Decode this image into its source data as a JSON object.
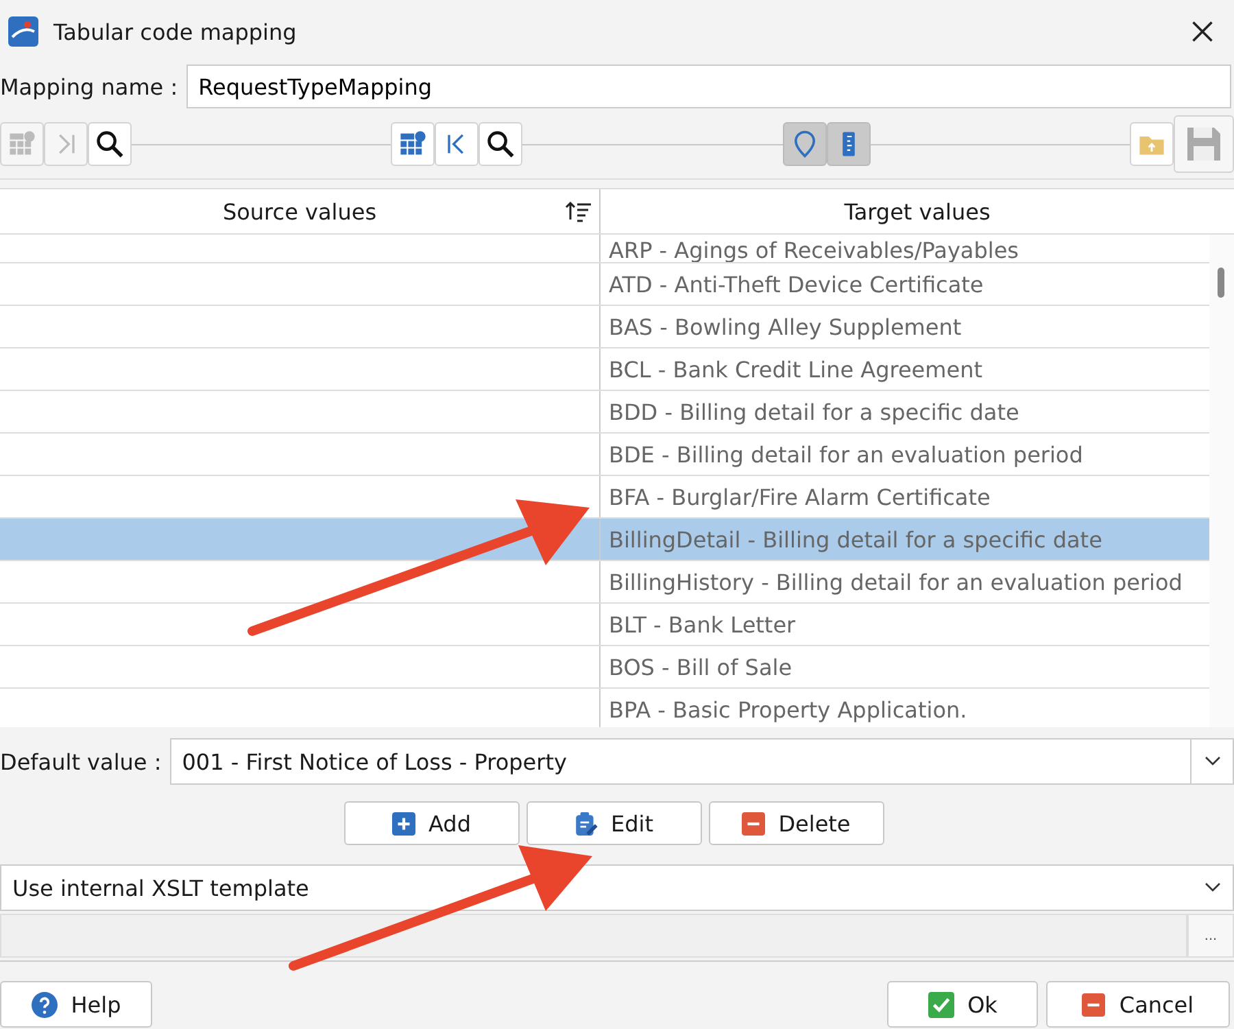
{
  "window": {
    "title": "Tabular code mapping"
  },
  "mapping": {
    "label": "Mapping name :",
    "value": "RequestTypeMapping"
  },
  "toolbar": [
    {
      "kind": "grid",
      "disabled": true,
      "pressed": false,
      "gap_after": false
    },
    {
      "kind": "last",
      "disabled": true,
      "pressed": false,
      "gap_after": false
    },
    {
      "kind": "search",
      "disabled": false,
      "pressed": false,
      "gap_after": true
    },
    {
      "kind": "grid",
      "disabled": false,
      "pressed": false,
      "gap_after": false
    },
    {
      "kind": "first",
      "disabled": false,
      "pressed": false,
      "gap_after": false
    },
    {
      "kind": "search",
      "disabled": false,
      "pressed": false,
      "gap_after": true
    },
    {
      "kind": "marker",
      "disabled": false,
      "pressed": true,
      "gap_after": false
    },
    {
      "kind": "ruler",
      "disabled": false,
      "pressed": true,
      "gap_after": true
    },
    {
      "kind": "folder",
      "disabled": false,
      "pressed": false,
      "gap_after": false
    },
    {
      "kind": "save",
      "disabled": true,
      "pressed": false,
      "gap_after": false
    }
  ],
  "table": {
    "columns": [
      "Source values",
      "Target values"
    ],
    "rows": [
      {
        "source": "",
        "target": "ARP - Agings of Receivables/Payables",
        "selected": false
      },
      {
        "source": "",
        "target": "ATD - Anti-Theft Device Certificate",
        "selected": false
      },
      {
        "source": "",
        "target": "BAS - Bowling Alley Supplement",
        "selected": false
      },
      {
        "source": "",
        "target": "BCL - Bank Credit Line Agreement",
        "selected": false
      },
      {
        "source": "",
        "target": "BDD - Billing detail for a specific date",
        "selected": false
      },
      {
        "source": "",
        "target": "BDE - Billing detail for an evaluation period",
        "selected": false
      },
      {
        "source": "",
        "target": "BFA - Burglar/Fire Alarm Certificate",
        "selected": false
      },
      {
        "source": "",
        "target": "BillingDetail - Billing detail for a specific date",
        "selected": true
      },
      {
        "source": "",
        "target": "BillingHistory - Billing detail for an evaluation period",
        "selected": false
      },
      {
        "source": "",
        "target": "BLT - Bank Letter",
        "selected": false
      },
      {
        "source": "",
        "target": "BOS - Bill of Sale",
        "selected": false
      },
      {
        "source": "",
        "target": "BPA - Basic Property Application.",
        "selected": false
      }
    ]
  },
  "default_value": {
    "label": "Default value :",
    "value": "001 - First Notice of Loss - Property"
  },
  "actions": [
    {
      "kind": "add",
      "label": "Add"
    },
    {
      "kind": "edit",
      "label": "Edit"
    },
    {
      "kind": "delete",
      "label": "Delete"
    }
  ],
  "template": {
    "value": "Use internal XSLT template"
  },
  "browse_button": "...",
  "footer": {
    "help": "Help",
    "ok": "Ok",
    "cancel": "Cancel"
  }
}
